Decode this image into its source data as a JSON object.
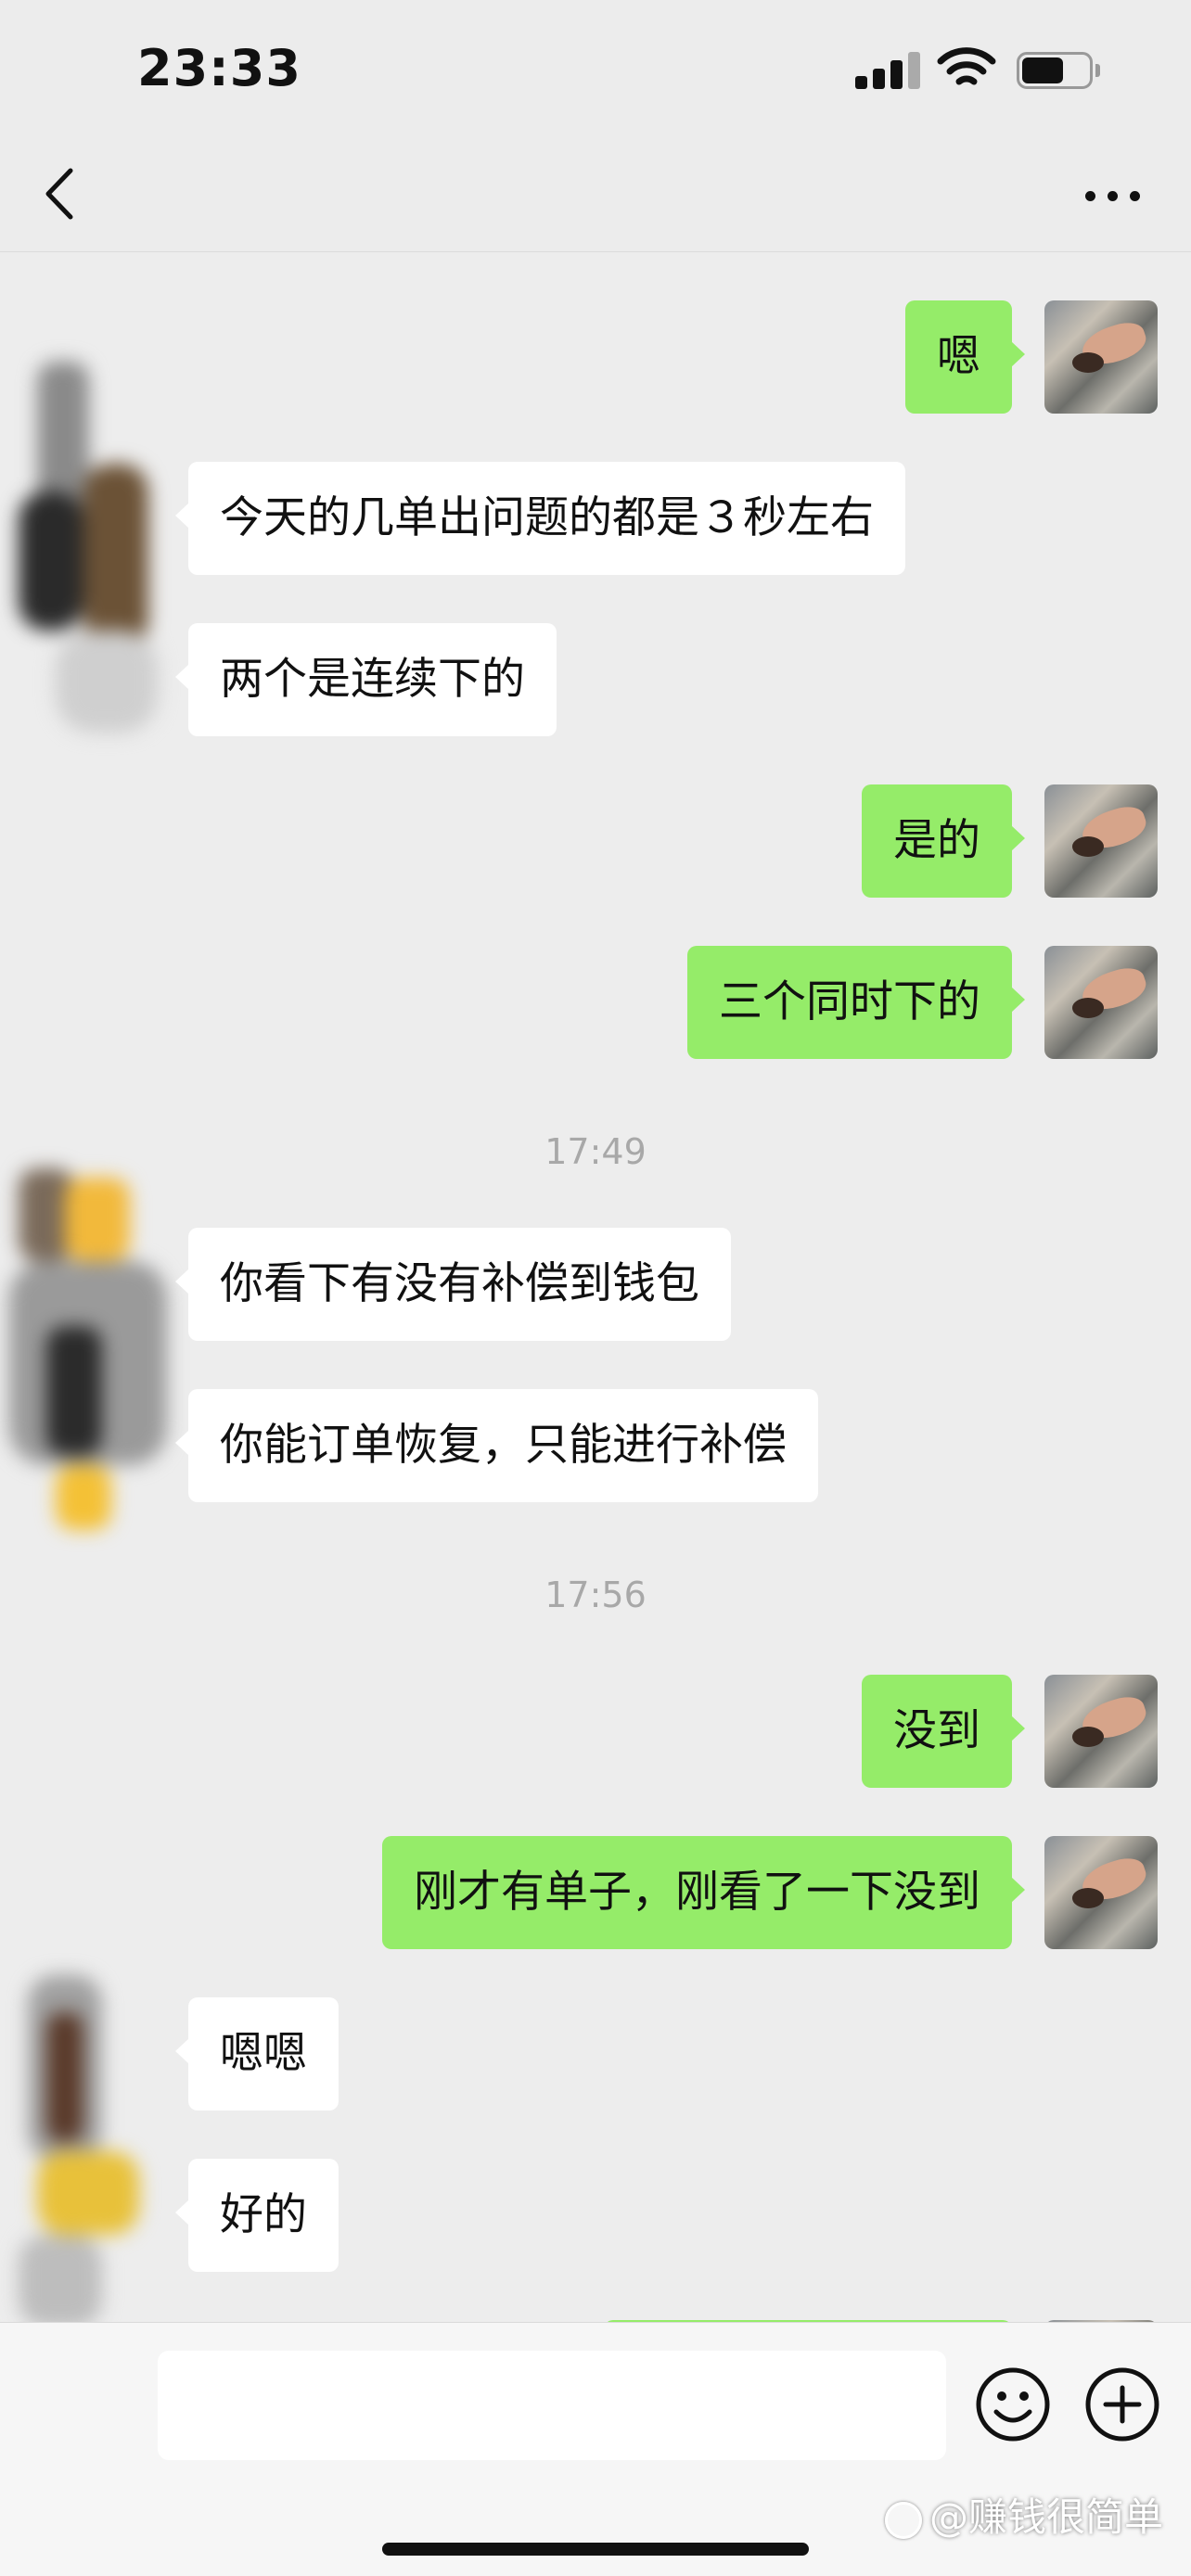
{
  "status_bar": {
    "time": "23:33",
    "icons": [
      "signal-icon",
      "wifi-icon",
      "battery-icon"
    ]
  },
  "nav": {
    "back_icon": "chevron-left-icon",
    "more_icon": "more-dots-icon"
  },
  "messages": [
    {
      "side": "out",
      "text": "嗯"
    },
    {
      "side": "in",
      "text": "今天的几单出问题的都是３秒左右"
    },
    {
      "side": "in",
      "text": "两个是连续下的"
    },
    {
      "side": "out",
      "text": "是的"
    },
    {
      "side": "out",
      "text": "三个同时下的"
    },
    {
      "side": "in",
      "text": "你看下有没有补偿到钱包"
    },
    {
      "side": "in",
      "text": "你能订单恢复，只能进行补偿"
    },
    {
      "side": "out",
      "text": "没到"
    },
    {
      "side": "out",
      "text": "刚才有单子，刚看了一下没到"
    },
    {
      "side": "in",
      "text": "嗯嗯"
    },
    {
      "side": "in",
      "text": "好的"
    }
  ],
  "timestamps": [
    "17:49",
    "17:56"
  ],
  "input_bar": {
    "emoji_icon": "emoji-icon",
    "plus_icon": "plus-circle-icon"
  },
  "watermark": "@赚钱很简单",
  "colors": {
    "background": "#ededed",
    "outgoing_bubble": "#95ec69",
    "incoming_bubble": "#ffffff",
    "timestamp": "#a8a8a8"
  }
}
